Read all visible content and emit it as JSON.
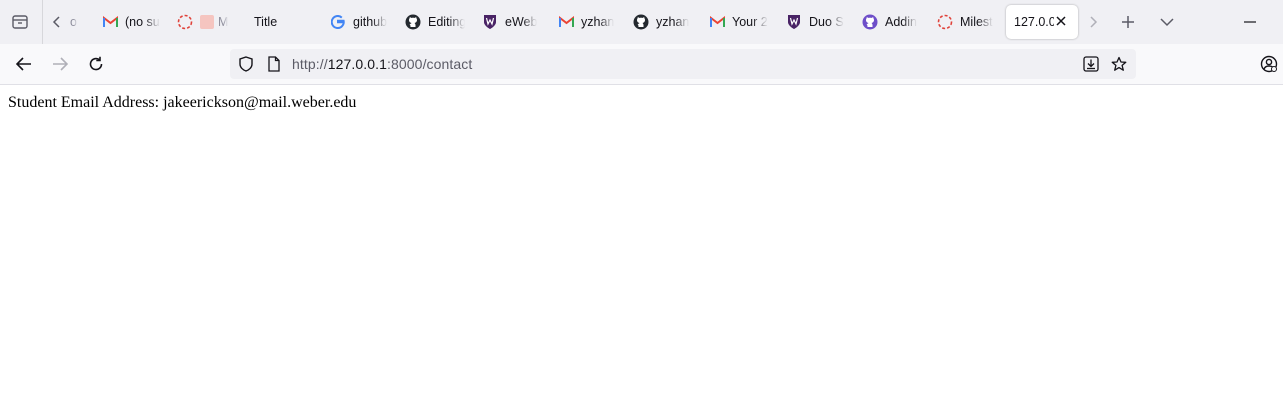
{
  "browser": {
    "tabs": [
      {
        "label": "(no su",
        "icon": "gmail-icon"
      },
      {
        "label": "M",
        "icon": "loading-icon"
      },
      {
        "label": "Title",
        "icon": ""
      },
      {
        "label": "github",
        "icon": "google-icon"
      },
      {
        "label": "Editing",
        "icon": "github-icon"
      },
      {
        "label": "eWeb",
        "icon": "weber-shield-icon"
      },
      {
        "label": "yzhan",
        "icon": "gmail-icon"
      },
      {
        "label": "yzhan",
        "icon": "github-icon"
      },
      {
        "label": "Your 2",
        "icon": "gmail-icon"
      },
      {
        "label": "Duo S",
        "icon": "weber-shield-icon"
      },
      {
        "label": "Addin",
        "icon": "github-icon"
      },
      {
        "label": "Milest",
        "icon": "loading-icon"
      },
      {
        "label": "127.0.0",
        "icon": "",
        "active": true
      }
    ],
    "hidden_tab_label": "o",
    "url": {
      "scheme": "http://",
      "host": "127.0.0.1",
      "path": ":8000/contact"
    }
  },
  "page": {
    "text": "Student Email Address: jakeerickson@mail.weber.edu"
  },
  "colors": {
    "tabbar_bg": "#f0f0f4",
    "toolbar_bg": "#f9f9fb",
    "gmail_red": "#ea4335",
    "weber_purple": "#492365",
    "github_black": "#24292f",
    "loading_red": "#e0423a"
  }
}
